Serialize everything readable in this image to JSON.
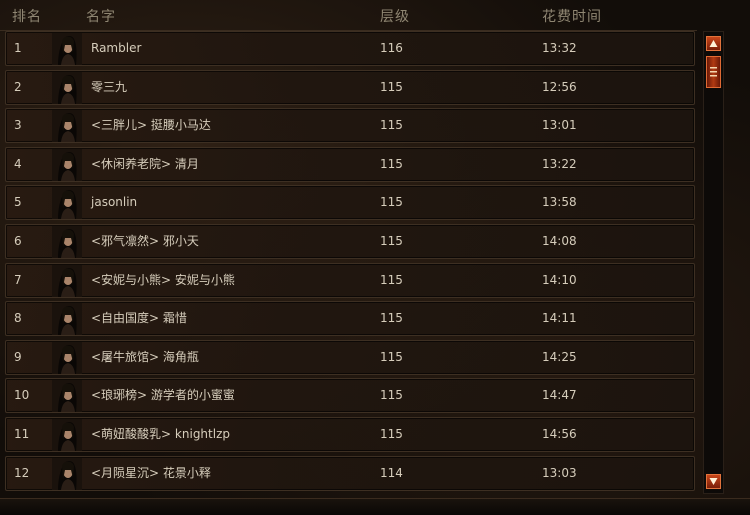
{
  "header": {
    "rank": "排名",
    "name": "名字",
    "level": "层级",
    "time": "花费时间"
  },
  "rows": [
    {
      "rank": "1",
      "name": "Rambler",
      "level": "116",
      "time": "13:32"
    },
    {
      "rank": "2",
      "name": "零三九",
      "level": "115",
      "time": "12:56"
    },
    {
      "rank": "3",
      "name": "<三胖儿> 挺腰小马达",
      "level": "115",
      "time": "13:01"
    },
    {
      "rank": "4",
      "name": "<休闲养老院> 清月",
      "level": "115",
      "time": "13:22"
    },
    {
      "rank": "5",
      "name": "jasonlin",
      "level": "115",
      "time": "13:58"
    },
    {
      "rank": "6",
      "name": "<邪气凛然> 邪小天",
      "level": "115",
      "time": "14:08"
    },
    {
      "rank": "7",
      "name": "<安妮与小熊> 安妮与小熊",
      "level": "115",
      "time": "14:10"
    },
    {
      "rank": "8",
      "name": "<自由国度> 霜惜",
      "level": "115",
      "time": "14:11"
    },
    {
      "rank": "9",
      "name": "<屠牛旅馆> 海角瓶",
      "level": "115",
      "time": "14:25"
    },
    {
      "rank": "10",
      "name": "<琅琊榜> 游学者的小蜜蜜",
      "level": "115",
      "time": "14:47"
    },
    {
      "rank": "11",
      "name": "<萌妞酸酸乳> knightlzp",
      "level": "115",
      "time": "14:56"
    },
    {
      "rank": "12",
      "name": "<月陨星沉> 花景小释",
      "level": "114",
      "time": "13:03"
    }
  ],
  "scrollbar": {
    "up_icon": "arrow-up-icon",
    "down_icon": "arrow-down-icon",
    "thumb_icon": "grip-icon"
  },
  "colors": {
    "accent": "#b13a12",
    "text": "#d6cdbb",
    "header_text": "#8f8672",
    "row_border": "#3d2f22"
  }
}
